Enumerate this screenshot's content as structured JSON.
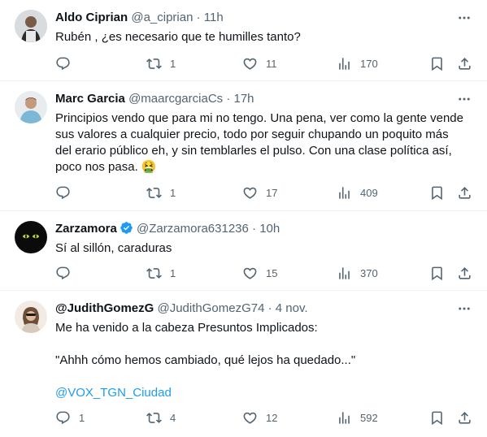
{
  "tweets": [
    {
      "name": "Aldo Ciprian",
      "handle": "@a_ciprian",
      "sep": "·",
      "time": "11h",
      "lines": [
        "Rubén , ¿es necesario que te humilles tanto?"
      ],
      "replies": "",
      "retweets": "1",
      "likes": "11",
      "views": "170"
    },
    {
      "name": "Marc Garcia",
      "handle": "@maarcgarciaCs",
      "sep": "·",
      "time": "17h",
      "lines": [
        "Principios vendo que para mi no tengo. Una pena, ver como la gente vende",
        "sus valores a cualquier precio, todo por seguir chupando un poquito más",
        "del erario público eh, y sin temblarles el pulso. Con una clase política así,",
        "poco nos pasa. 🤮"
      ],
      "replies": "",
      "retweets": "1",
      "likes": "17",
      "views": "409"
    },
    {
      "name": "Zarzamora",
      "handle": "@Zarzamora631236",
      "sep": "·",
      "time": "10h",
      "verified": true,
      "lines": [
        "Sí al sillón, caraduras"
      ],
      "replies": "",
      "retweets": "1",
      "likes": "15",
      "views": "370"
    },
    {
      "name": "@JudithGomezG",
      "handle": "@JudithGomezG74",
      "sep": "·",
      "time": "4 nov.",
      "lines": [
        "Me ha venido a la cabeza Presuntos Implicados:",
        "\"Ahhh cómo hemos cambiado, qué lejos ha quedado...\"",
        "@VOX_TGN_Ciudad"
      ],
      "replies": "1",
      "retweets": "4",
      "likes": "12",
      "views": "592"
    }
  ],
  "colors": {
    "text": "#0f1419",
    "muted": "#536471",
    "link": "#1d9bf0",
    "border": "#eff3f4",
    "verified": "#1d9bf0"
  },
  "icons": [
    "reply-icon",
    "retweet-icon",
    "like-icon",
    "views-icon",
    "bookmark-icon",
    "share-icon",
    "more-icon",
    "verified-badge-icon"
  ]
}
